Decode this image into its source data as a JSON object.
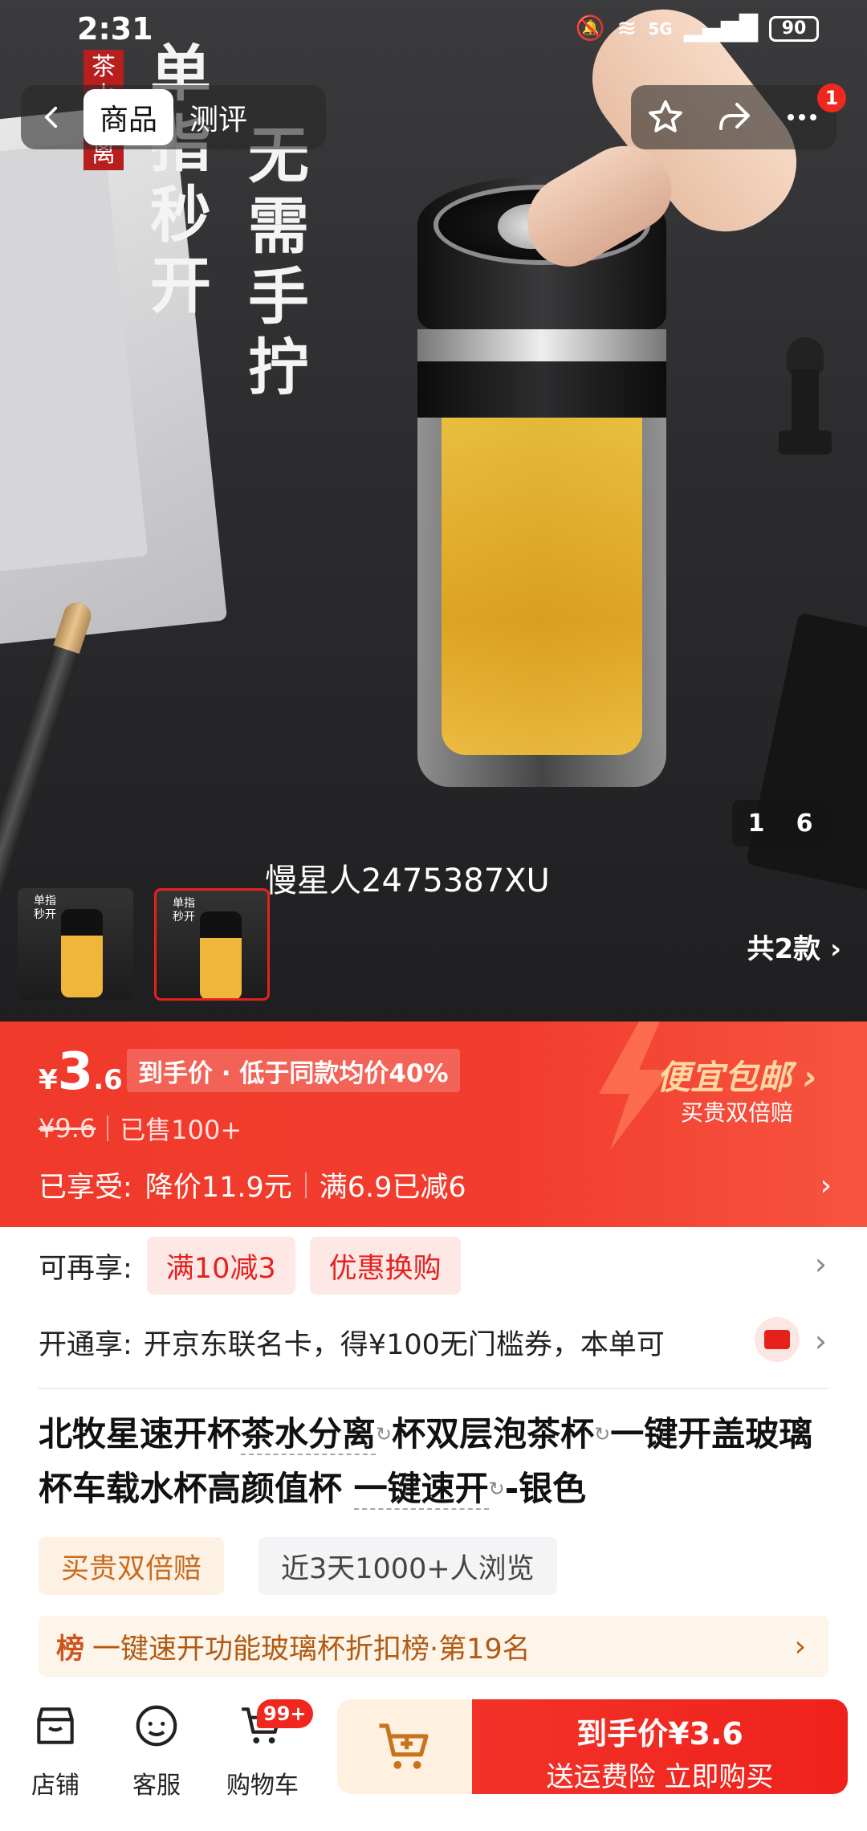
{
  "status": {
    "time": "2:31",
    "network": "5G",
    "battery": "90"
  },
  "nav": {
    "tabs": [
      "商品",
      "测评"
    ],
    "badge_count": "1"
  },
  "hero": {
    "vertical_tag": "茶水分离",
    "text_col1": "单指秒开",
    "text_col2": "无需手拧",
    "counter_current": "1",
    "counter_total": "6",
    "watermark": "慢星人2475387XU",
    "variants_label": "共2款"
  },
  "price": {
    "symbol": "¥",
    "integer": "3",
    "decimal": ".6",
    "note": "到手价 · 低于同款均价40%",
    "original": "¥9.6",
    "sold": "已售100+",
    "promo_title": "便宜包邮",
    "promo_sub": "买贵双倍赔",
    "enjoyed_label": "已享受:",
    "discount1": "降价11.9元",
    "discount2": "满6.9已减6"
  },
  "offers": {
    "label": "可再享:",
    "coupons": [
      "满10减3",
      "优惠换购"
    ],
    "card_label": "开通享:",
    "card_text": "开京东联名卡，得¥100无门槛券，本单可"
  },
  "product": {
    "title_parts": [
      "北牧星速开杯",
      "茶水分离",
      "杯双层泡茶杯",
      "一键开盖玻璃杯车载水杯高颜值杯 ",
      "一键速开",
      "-银色"
    ],
    "tags": [
      "买贵双倍赔",
      "近3天1000+人浏览"
    ],
    "rank_badge": "榜",
    "rank_text": "一键速开功能玻璃杯折扣榜·第19名"
  },
  "bottom": {
    "shop": "店铺",
    "service": "客服",
    "cart": "购物车",
    "cart_badge": "99+",
    "buy_line1": "到手价¥3.6",
    "buy_line2": "送运费险 立即购买"
  },
  "colors": {
    "accent": "#f0271f",
    "price_bg": "#f23d2e",
    "promo": "#ffd7a3"
  }
}
